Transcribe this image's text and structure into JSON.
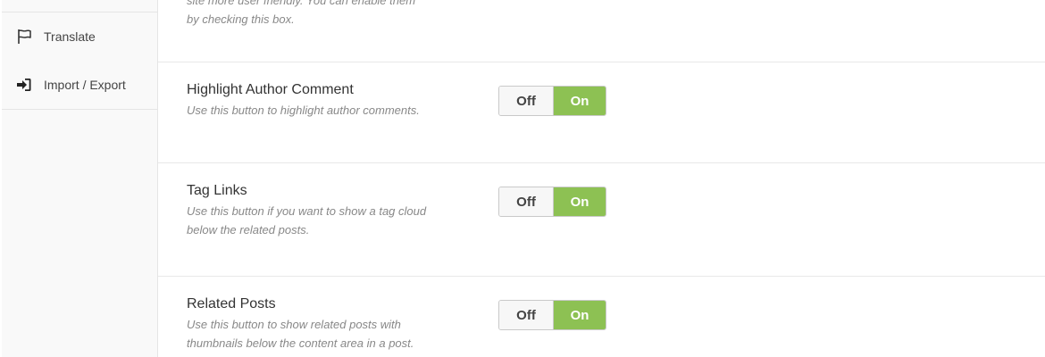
{
  "sidebar": {
    "items": [
      {
        "label": "Translate",
        "icon": "flag-icon"
      },
      {
        "label": "Import / Export",
        "icon": "sign-in-icon"
      }
    ]
  },
  "colors": {
    "toggle_on": "#8dc153"
  },
  "settings": {
    "cut_off_desc": {
      "line1": "site more user friendly. You can enable them",
      "line2": "by checking this box."
    },
    "rows": [
      {
        "title": "Highlight Author Comment",
        "desc_lines": [
          "Use this button to highlight author comments."
        ],
        "off_label": "Off",
        "on_label": "On",
        "state": "on"
      },
      {
        "title": "Tag Links",
        "desc_lines": [
          "Use this button if you want to show a tag cloud",
          "below the related posts."
        ],
        "off_label": "Off",
        "on_label": "On",
        "state": "on"
      },
      {
        "title": "Related Posts",
        "desc_lines": [
          "Use this button to show related posts with",
          "thumbnails below the content area in a post."
        ],
        "off_label": "Off",
        "on_label": "On",
        "state": "on"
      }
    ]
  }
}
